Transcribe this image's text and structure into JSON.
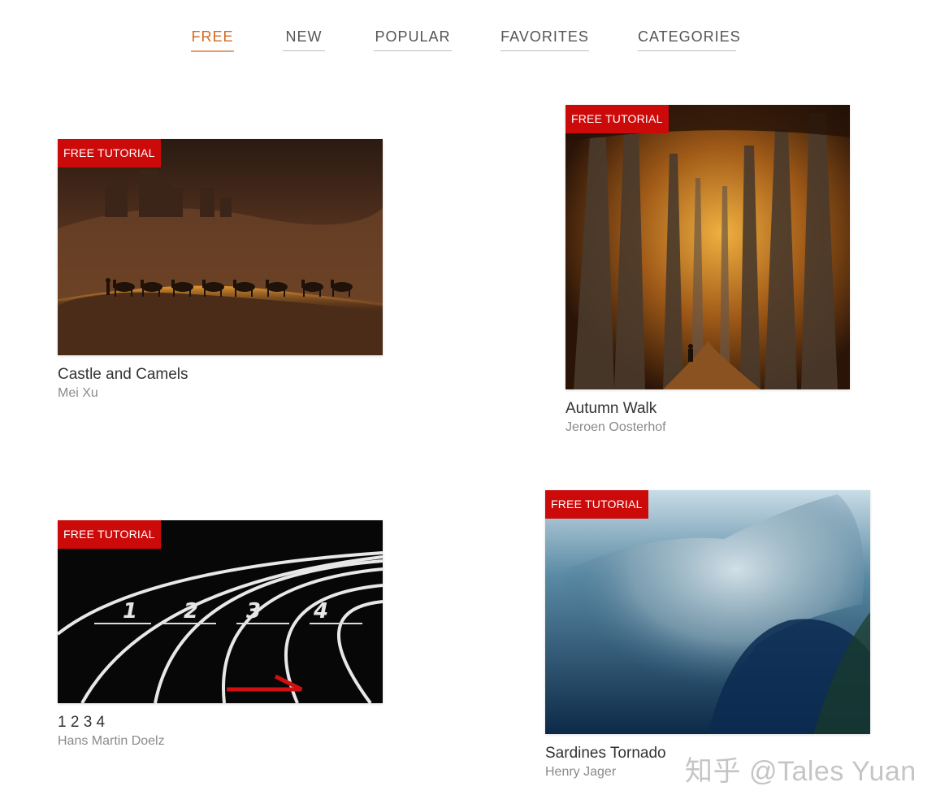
{
  "nav": {
    "tabs": [
      {
        "label": "FREE",
        "active": true
      },
      {
        "label": "NEW",
        "active": false
      },
      {
        "label": "POPULAR",
        "active": false
      },
      {
        "label": "FAVORITES",
        "active": false
      },
      {
        "label": "CATEGORIES",
        "active": false
      }
    ]
  },
  "cards": [
    {
      "badge": "FREE TUTORIAL",
      "title": "Castle and Camels",
      "author": "Mei Xu"
    },
    {
      "badge": "FREE TUTORIAL",
      "title": "Autumn Walk",
      "author": "Jeroen Oosterhof"
    },
    {
      "badge": "FREE TUTORIAL",
      "title": "1 2 3 4",
      "author": "Hans Martin Doelz"
    },
    {
      "badge": "FREE TUTORIAL",
      "title": "Sardines Tornado",
      "author": "Henry Jager"
    }
  ],
  "watermark": "知乎 @Tales Yuan",
  "colors": {
    "accent": "#d2691e",
    "badge": "#cc0a0a",
    "title": "#333333",
    "author": "#8a8a8a"
  }
}
